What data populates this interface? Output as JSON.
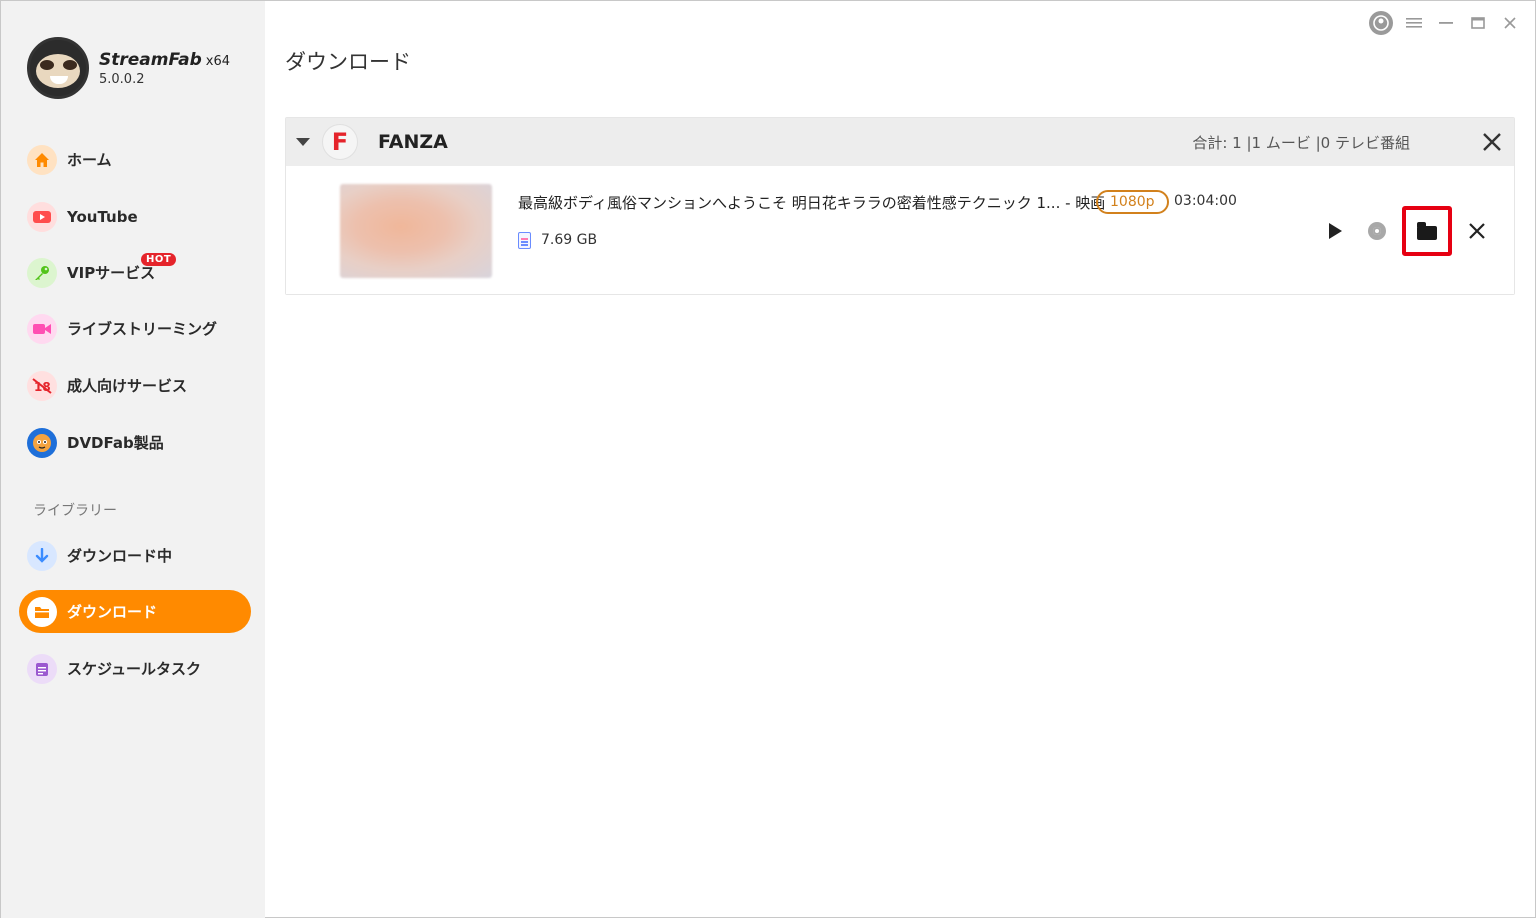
{
  "app": {
    "name": "StreamFab",
    "arch": "x64",
    "version": "5.0.0.2"
  },
  "sidebar": {
    "items": [
      {
        "label": "ホーム",
        "icon": "home-icon",
        "color": "#ff8a00"
      },
      {
        "label": "YouTube",
        "icon": "youtube-icon",
        "color": "#ff4d4d"
      },
      {
        "label": "VIPサービス",
        "icon": "key-icon",
        "color": "#52c41a",
        "badge": "HOT"
      },
      {
        "label": "ライブストリーミング",
        "icon": "camera-icon",
        "color": "#ff4fb3"
      },
      {
        "label": "成人向けサービス",
        "icon": "adult-18-icon",
        "color": "#e5242b"
      },
      {
        "label": "DVDFab製品",
        "icon": "dvdfab-icon",
        "color": "#1e6fd9"
      }
    ],
    "library_title": "ライブラリー",
    "library_items": [
      {
        "label": "ダウンロード中",
        "icon": "download-arrow-icon",
        "color": "#3b8cff"
      },
      {
        "label": "ダウンロード",
        "icon": "folder-icon",
        "color": "#ff8a00",
        "active": true
      },
      {
        "label": "スケジュールタスク",
        "icon": "schedule-icon",
        "color": "#9b59d0"
      }
    ]
  },
  "main": {
    "page_title": "ダウンロード",
    "group": {
      "logo_letter": "F",
      "name": "FANZA",
      "summary": "合計: 1 |1 ムービ |0 テレビ番組"
    },
    "item": {
      "title": "最高級ボディ風俗マンションへようこそ 明日花キララの密着性感テクニック 1... - 映画",
      "resolution": "1080p",
      "duration": "03:04:00",
      "size": "7.69 GB"
    }
  },
  "colors": {
    "accent": "#ff8a00",
    "highlight_box": "#e60012",
    "badge_border": "#d2811c"
  }
}
